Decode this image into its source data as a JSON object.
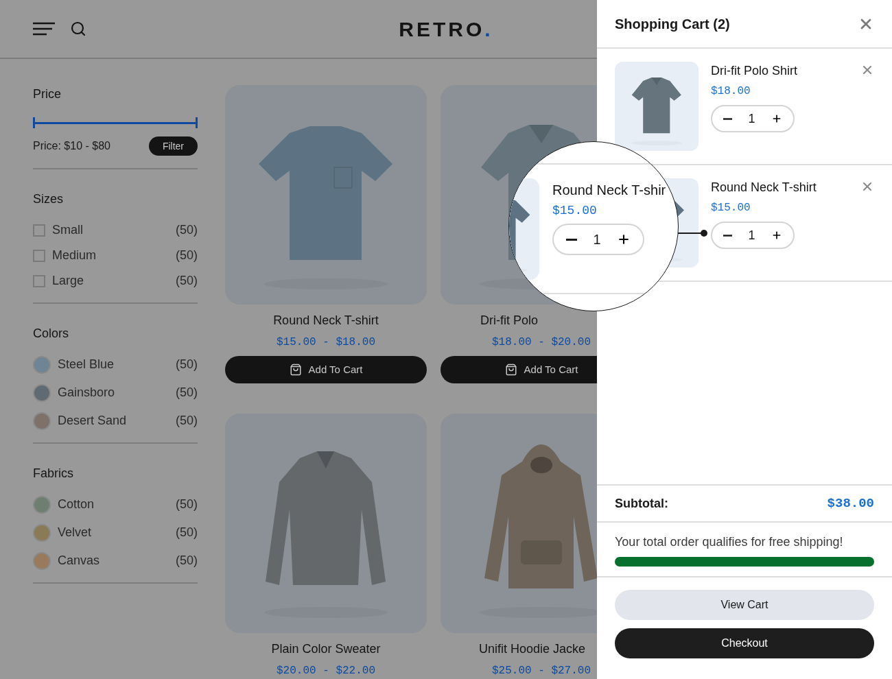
{
  "header": {
    "logo": "RETRO",
    "logo_dot": "."
  },
  "filters": {
    "price": {
      "title": "Price",
      "level": 1,
      "reading": "Price: $10 - $80",
      "button": "Filter"
    },
    "sizes": {
      "title": "Sizes",
      "items": [
        {
          "label": "Small",
          "count": "(50)",
          "checked": false
        },
        {
          "label": "Medium",
          "count": "(50)",
          "checked": false
        },
        {
          "label": "Large",
          "count": "(50)",
          "checked": false
        }
      ]
    },
    "colors": {
      "title": "Colors",
      "items": [
        {
          "label": "Steel Blue",
          "count": "(50)",
          "color": "#6f8594"
        },
        {
          "label": "Gainsboro",
          "count": "(50)",
          "color": "#5f6a72"
        },
        {
          "label": "Desert Sand",
          "count": "(50)",
          "color": "#7d716a"
        }
      ]
    },
    "fabrics": {
      "title": "Fabrics",
      "items": [
        {
          "label": "Cotton",
          "count": "(50)",
          "color": "#6e7f72"
        },
        {
          "label": "Velvet",
          "count": "(50)",
          "color": "#8a7a55"
        },
        {
          "label": "Canvas",
          "count": "(50)",
          "color": "#9a7a5c"
        }
      ]
    }
  },
  "products": [
    {
      "name": "Round Neck T-shirt",
      "price": "$15.00 - $18.00",
      "button": "Add To Cart"
    },
    {
      "name": "Dri-fit Polo",
      "price": "$18.00 - $20.00",
      "button": "Add To Cart"
    },
    {
      "name": "Plain Color Sweater",
      "price": "$20.00 - $22.00"
    },
    {
      "name": "Unifit Hoodie Jacke",
      "price": "$25.00 - $27.00"
    }
  ],
  "cart": {
    "title": "Shopping Cart (2)",
    "items": [
      {
        "name": "Dri-fit Polo Shirt",
        "price": "$18.00",
        "quantity": "1"
      },
      {
        "name": "Round Neck T-shirt",
        "price": "$15.00",
        "quantity": "1"
      }
    ],
    "subtotal_label": "Subtotal:",
    "subtotal": "$38.00",
    "shipping": {
      "message": "Your total order qualifies for free shipping!",
      "level": 1
    },
    "buttons": [
      {
        "label": "View Cart",
        "kind": "secondary"
      },
      {
        "label": "Checkout",
        "kind": "primary"
      }
    ]
  },
  "magnifier": {
    "name": "Round Neck T-shir",
    "price": "$15.00",
    "quantity": "1"
  }
}
